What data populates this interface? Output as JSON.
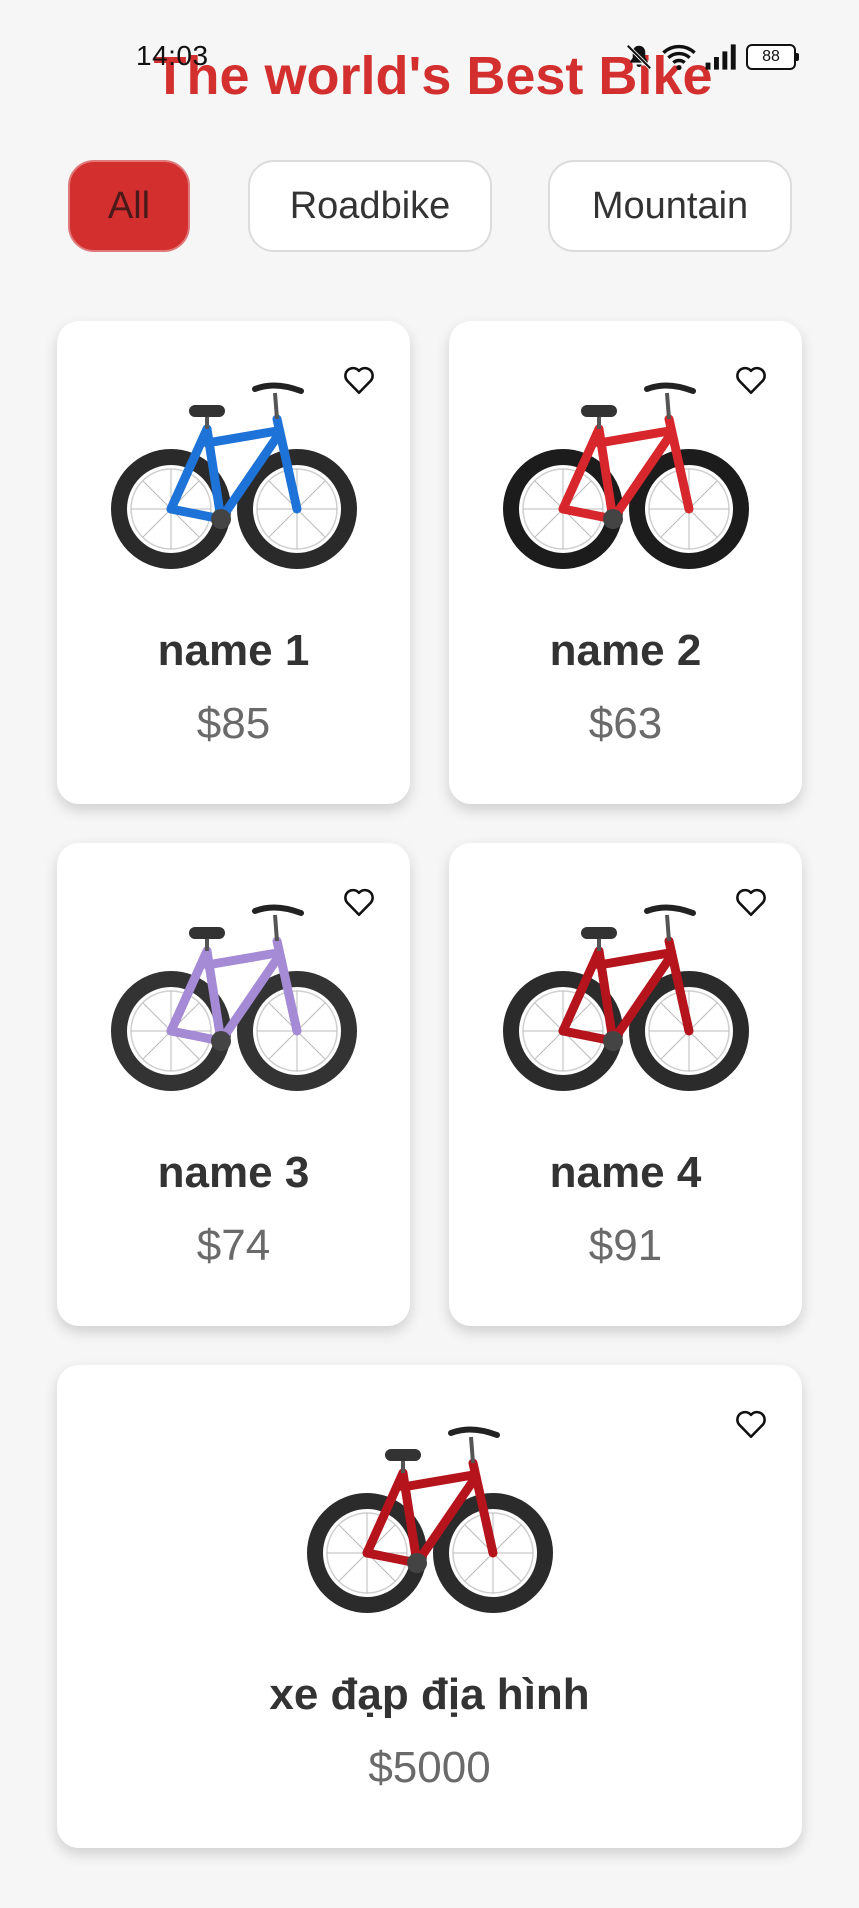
{
  "status_bar": {
    "time": "14:03",
    "battery": "88"
  },
  "app": {
    "title": "The world's Best Bike"
  },
  "filters": [
    {
      "label": "All",
      "active": true
    },
    {
      "label": "Roadbike",
      "active": false
    },
    {
      "label": "Mountain",
      "active": false
    }
  ],
  "products": [
    {
      "name": "name 1",
      "price": "$85",
      "bike_color": "#1e73d8",
      "tire_color": "#2a2a2a"
    },
    {
      "name": "name 2",
      "price": "$63",
      "bike_color": "#d7262c",
      "tire_color": "#1c1c1c"
    },
    {
      "name": "name 3",
      "price": "$74",
      "bike_color": "#a58ad6",
      "tire_color": "#333333"
    },
    {
      "name": "name 4",
      "price": "$91",
      "bike_color": "#b5141c",
      "tire_color": "#2b2b2b"
    },
    {
      "name": "xe đạp địa hình",
      "price": "$5000",
      "bike_color": "#b5141c",
      "tire_color": "#2b2b2b"
    }
  ],
  "colors": {
    "accent": "#d32f2f",
    "background": "#f6f6f6",
    "card": "#ffffff"
  },
  "icons": {
    "favorite": "heart-outline-icon",
    "status": [
      "mute-bell-icon",
      "wifi-icon",
      "signal-icon",
      "battery-icon"
    ]
  }
}
